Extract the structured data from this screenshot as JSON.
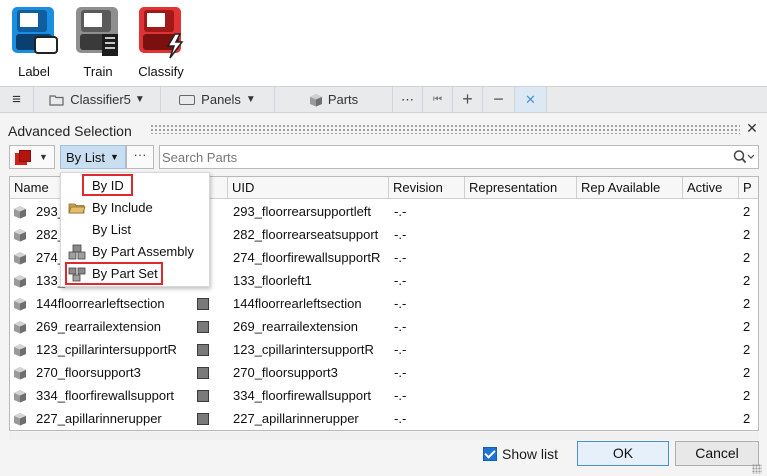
{
  "ribbon": {
    "tools": [
      {
        "label": "Label",
        "icon": "label-tool-icon"
      },
      {
        "label": "Train",
        "icon": "train-tool-icon"
      },
      {
        "label": "Classify",
        "icon": "classify-tool-icon"
      }
    ]
  },
  "tabbar": {
    "menu_icon": "≡",
    "classifier_tab": "Classifier5",
    "panels_tab": "Panels",
    "parts_tab": "Parts",
    "more": "⋯",
    "first": "⏮",
    "add": "+",
    "remove": "−",
    "close": "✕"
  },
  "panel": {
    "title": "Advanced Selection",
    "close": "✕",
    "by_list_label": "By List",
    "dots_label": "···",
    "search_placeholder": "Search Parts",
    "columns": [
      "Name",
      "",
      "UID",
      "Revision",
      "Representation",
      "Rep Available",
      "Active",
      "P"
    ],
    "rows": [
      {
        "name": "293_",
        "uid": "293_floorrearsupportleft",
        "revision": "-.-",
        "extra": "2"
      },
      {
        "name": "282_",
        "uid": "282_floorrearseatsupport",
        "revision": "-.-",
        "extra": "2"
      },
      {
        "name": "274_",
        "uid": "274_floorfirewallsupportR",
        "revision": "-.-",
        "extra": "2"
      },
      {
        "name": "133_",
        "uid": "133_floorleft1",
        "revision": "-.-",
        "extra": "2"
      },
      {
        "name": "144floorrearleftsection",
        "uid": "144floorrearleftsection",
        "revision": "-.-",
        "extra": "2"
      },
      {
        "name": "269_rearrailextension",
        "uid": "269_rearrailextension",
        "revision": "-.-",
        "extra": "2"
      },
      {
        "name": "123_cpillarintersupportR",
        "uid": "123_cpillarintersupportR",
        "revision": "-.-",
        "extra": "2"
      },
      {
        "name": "270_floorsupport3",
        "uid": "270_floorsupport3",
        "revision": "-.-",
        "extra": "2"
      },
      {
        "name": "334_floorfirewallsupport",
        "uid": "334_floorfirewallsupport",
        "revision": "-.-",
        "extra": "2"
      },
      {
        "name": "227_apillarinnerupper",
        "uid": "227_apillarinnerupper",
        "revision": "-.-",
        "extra": "2"
      }
    ],
    "menu": [
      {
        "label": "By ID",
        "icon": "",
        "highlighted": true
      },
      {
        "label": "By Include",
        "icon": "folder-icon",
        "highlighted": false
      },
      {
        "label": "By List",
        "icon": "",
        "highlighted": false
      },
      {
        "label": "By Part Assembly",
        "icon": "part-assembly-icon",
        "highlighted": false
      },
      {
        "label": "By Part Set",
        "icon": "part-set-icon",
        "highlighted": true
      }
    ],
    "show_list_label": "Show list",
    "show_list_checked": true,
    "ok_label": "OK",
    "cancel_label": "Cancel"
  },
  "colors": {
    "accent": "#1f74d3",
    "highlight_box": "#e0282e",
    "selection_bg": "#c9dff1"
  }
}
